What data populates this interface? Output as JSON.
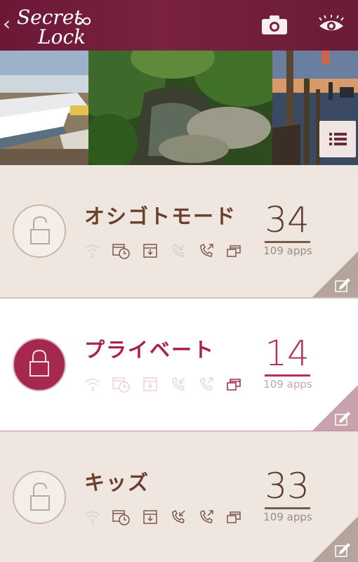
{
  "header": {
    "back_glyph": "‹",
    "logo_line1": "Secret",
    "logo_line2": "Lock",
    "camera_icon": "camera-icon",
    "eye_icon": "eye-icon"
  },
  "profiles": [
    {
      "name": "オシゴトモード",
      "count": "34",
      "apps": "109 apps",
      "state": "unlocked"
    },
    {
      "name": "プライベート",
      "count": "14",
      "apps": "109 apps",
      "state": "locked"
    },
    {
      "name": "キッズ",
      "count": "33",
      "apps": "109 apps",
      "state": "unlocked"
    }
  ],
  "colors": {
    "brand": "#7a2240",
    "accent": "#a5294f",
    "text_brown": "#6a3f2d"
  }
}
